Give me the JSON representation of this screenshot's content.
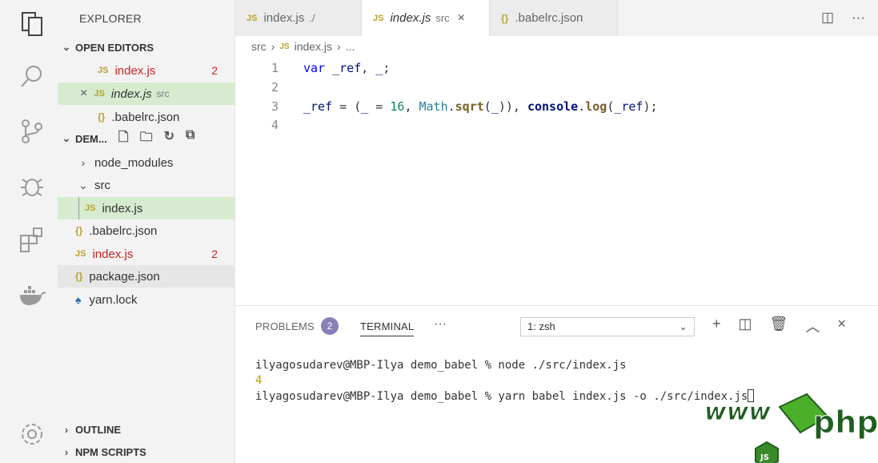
{
  "sidebar": {
    "title": "EXPLORER",
    "open_editors_label": "OPEN EDITORS",
    "open_editors": [
      {
        "name": "index.js",
        "desc": "",
        "badge": "2"
      },
      {
        "name": "index.js",
        "desc": "src",
        "badge": ""
      },
      {
        "name": ".babelrc.json",
        "desc": "",
        "badge": ""
      }
    ],
    "folder_label": "DEM...",
    "tree": [
      {
        "name": "node_modules"
      },
      {
        "name": "src"
      },
      {
        "name": "index.js"
      },
      {
        "name": ".babelrc.json"
      },
      {
        "name": "index.js",
        "badge": "2"
      },
      {
        "name": "package.json"
      },
      {
        "name": "yarn.lock"
      }
    ],
    "outline_label": "OUTLINE",
    "npm_label": "NPM SCRIPTS"
  },
  "tabs": [
    {
      "name": "index.js",
      "desc": "./"
    },
    {
      "name": "index.js",
      "desc": "src"
    },
    {
      "name": ".babelrc.json",
      "desc": ""
    }
  ],
  "breadcrumb": {
    "folder": "src",
    "file": "index.js",
    "more": "..."
  },
  "editor": {
    "line_numbers": [
      "1",
      "2",
      "3",
      "4"
    ]
  },
  "panel": {
    "problems_label": "PROBLEMS",
    "problems_count": "2",
    "terminal_label": "TERMINAL",
    "more_label": "···",
    "terminal_select": "1: zsh",
    "lines": [
      "ilyagosudarev@MBP-Ilya demo_babel % node ./src/index.js",
      "4",
      "ilyagosudarev@MBP-Ilya demo_babel % yarn babel index.js -o ./src/index.js"
    ]
  },
  "watermark": {
    "www": "www",
    "php": "php",
    "js": "JS"
  },
  "colors": {
    "accent_green": "#d6ebd0",
    "error": "#cc2222",
    "js_icon": "#b8a22a",
    "badge": "#8a7fb8"
  }
}
